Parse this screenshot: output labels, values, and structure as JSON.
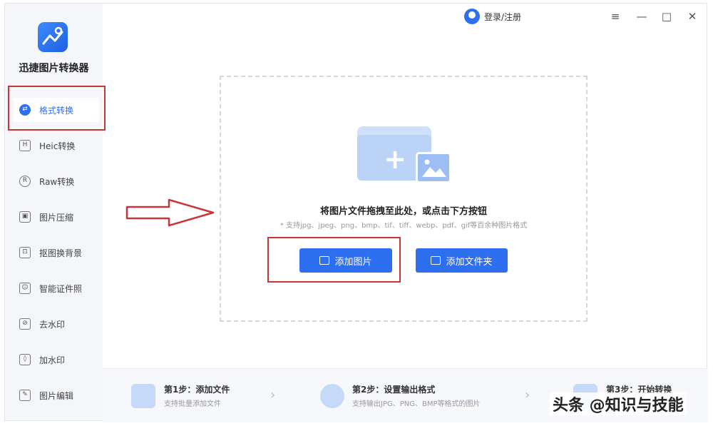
{
  "app": {
    "name": "迅捷图片转换器"
  },
  "titlebar": {
    "login_label": "登录/注册",
    "menu_icon": "≡",
    "minimize_icon": "—",
    "maximize_icon": "□",
    "close_icon": "✕"
  },
  "sidebar": {
    "items": [
      {
        "label": "格式转换",
        "icon": "⇄",
        "active": true
      },
      {
        "label": "Heic转换",
        "icon": "H",
        "active": false
      },
      {
        "label": "Raw转换",
        "icon": "R",
        "active": false
      },
      {
        "label": "图片压缩",
        "icon": "▣",
        "active": false
      },
      {
        "label": "抠图换背景",
        "icon": "⊡",
        "active": false
      },
      {
        "label": "智能证件照",
        "icon": "☺",
        "active": false
      },
      {
        "label": "去水印",
        "icon": "⊘",
        "active": false
      },
      {
        "label": "加水印",
        "icon": "◊",
        "active": false
      },
      {
        "label": "图片编辑",
        "icon": "✎",
        "active": false
      }
    ]
  },
  "dropzone": {
    "main_text": "将图片文件拖拽至此处，或点击下方按钮",
    "sub_text": "* 支持jpg、jpeg、png、bmp、tif、tiff、webp、pdf、gif等百余种图片格式",
    "add_image_label": "添加图片",
    "add_folder_label": "添加文件夹"
  },
  "steps": [
    {
      "title": "第1步：添加文件",
      "desc": "支持批量添加文件"
    },
    {
      "title": "第2步：设置输出格式",
      "desc": "支持输出JPG、PNG、BMP等格式的图片"
    },
    {
      "title": "第3步：开始转换",
      "desc": ""
    }
  ],
  "watermark": "头条 @知识与技能",
  "colors": {
    "accent": "#2e6ff0",
    "highlight": "#c8363a"
  }
}
